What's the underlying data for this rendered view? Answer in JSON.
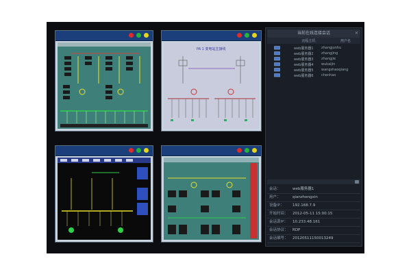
{
  "windows": [
    {
      "id": "top-left"
    },
    {
      "id": "top-right",
      "title": "PA 1 变电站主接线"
    },
    {
      "id": "bottom-left"
    },
    {
      "id": "bottom-right"
    }
  ],
  "panel": {
    "title": "当前在线连接会话",
    "columns": [
      "",
      "远程主机",
      "用户名"
    ],
    "sessions": [
      {
        "host": "web服务器1",
        "user": "zhangjunhu"
      },
      {
        "host": "web服务器2",
        "user": "zhangjing"
      },
      {
        "host": "web服务器3",
        "user": "zhangjie"
      },
      {
        "host": "web服务器4",
        "user": "wukaijin"
      },
      {
        "host": "web服务器5",
        "user": "wangshaoqiang"
      },
      {
        "host": "web服务器6",
        "user": "chenhao"
      }
    ],
    "info": [
      {
        "k": "会话：",
        "v": "web服务器1"
      },
      {
        "k": "用户：",
        "v": "qianzhengxin"
      },
      {
        "k": "设备IP：",
        "v": "192.168.7.9"
      },
      {
        "k": "开始时间：",
        "v": "2012-05-11 15:00:15"
      },
      {
        "k": "会话源IP：",
        "v": "10.233.48.161"
      },
      {
        "k": "会话协议：",
        "v": "RDP"
      },
      {
        "k": "会话编号：",
        "v": "20120511150013249"
      }
    ]
  },
  "colors": {
    "frame": "#0b0d11",
    "titlebar": "#1b3f7a",
    "panel": "#1a1f27"
  }
}
